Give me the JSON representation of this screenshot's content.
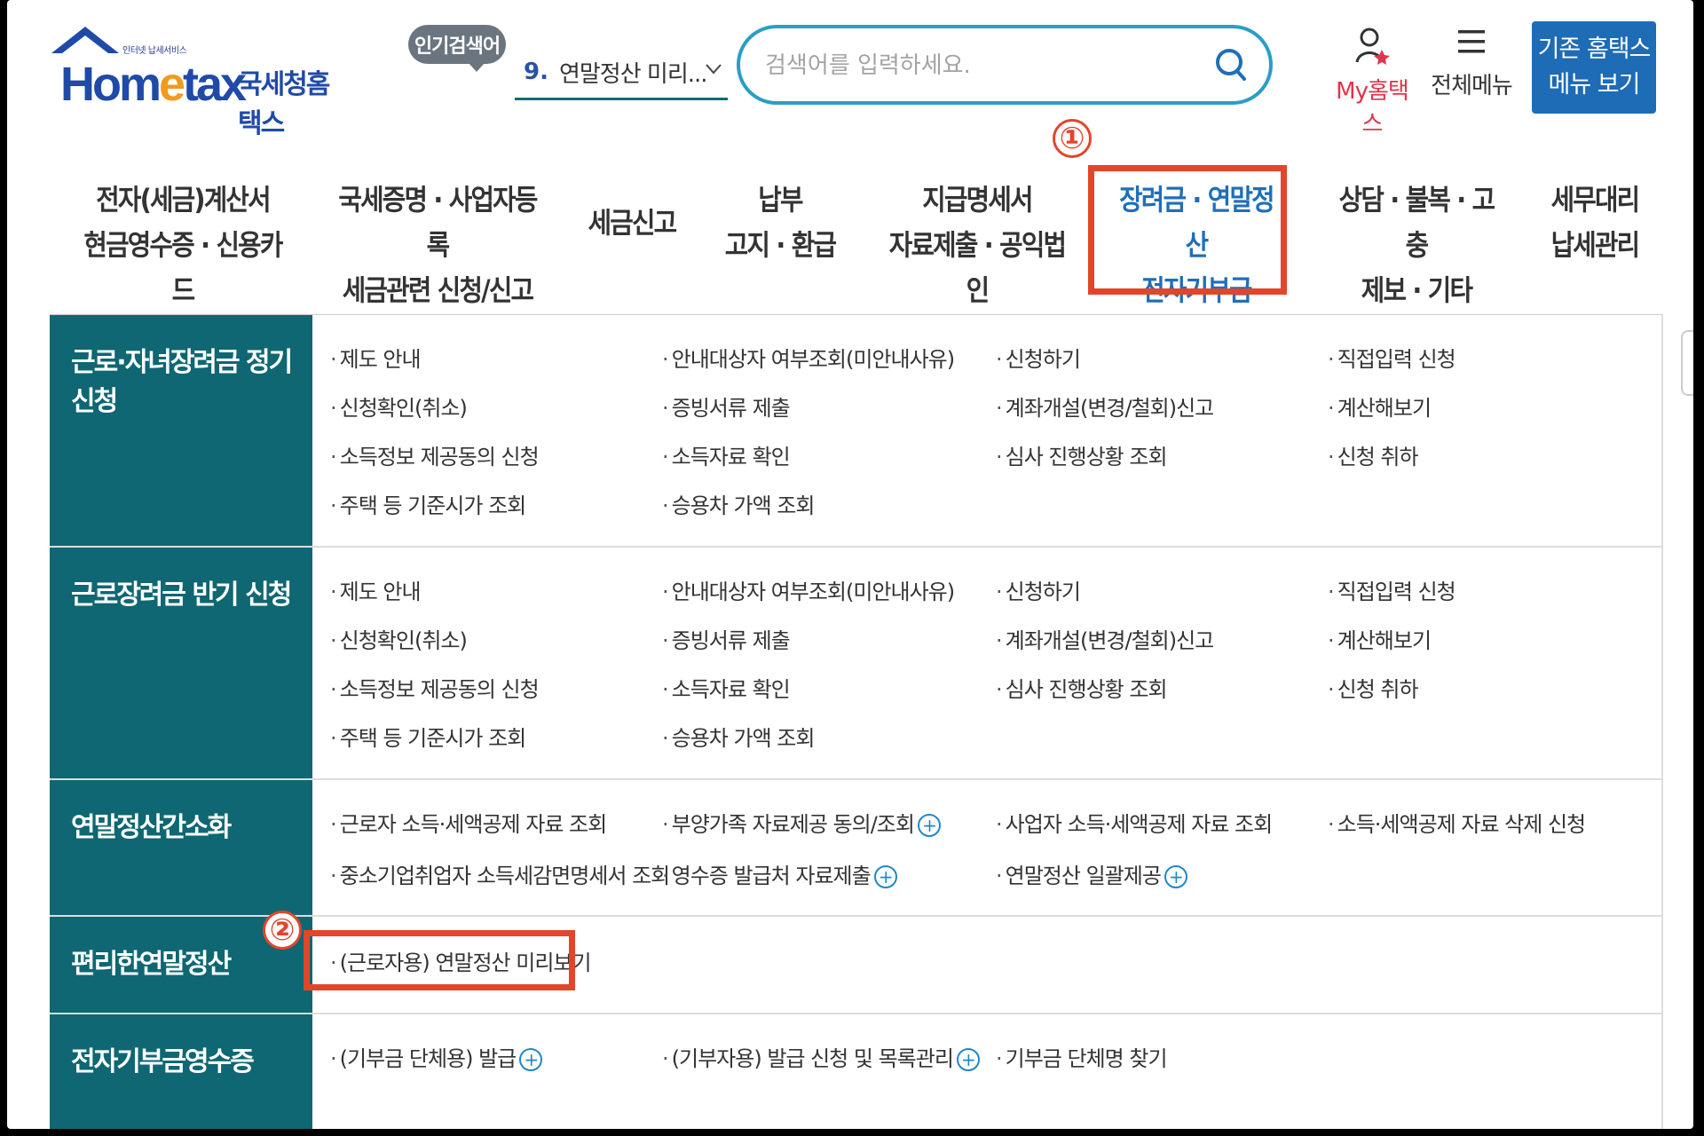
{
  "logo": {
    "small_text": "인터넷 납세서비스",
    "brand_pre": "Hom",
    "brand_e": "e",
    "brand_post": "tax",
    "brand_kor": "국세청홈택스"
  },
  "header": {
    "popular_badge": "인기검색어",
    "popular_num": "9.",
    "popular_text": "연말정산 미리...",
    "search_placeholder": "검색어를 입력하세요.",
    "my_label": "My홈택스",
    "all_menu_label": "전체메뉴",
    "legacy_line1": "기존 홈택스",
    "legacy_line2": "메뉴 보기"
  },
  "annotations": {
    "first": "①",
    "second": "②"
  },
  "nav": [
    {
      "line1": "전자(세금)계산서",
      "line2": "현금영수증 · 신용카드"
    },
    {
      "line1": "국세증명 · 사업자등록",
      "line2": "세금관련 신청/신고"
    },
    {
      "line1": "세금신고",
      "line2": ""
    },
    {
      "line1": "납부",
      "line2": "고지 · 환급"
    },
    {
      "line1": "지급명세서",
      "line2": "자료제출 · 공익법인"
    },
    {
      "line1": "장려금 · 연말정산",
      "line2": "전자기부금"
    },
    {
      "line1": "상담 · 불복 · 고충",
      "line2": "제보 · 기타"
    },
    {
      "line1": "세무대리",
      "line2": "납세관리"
    }
  ],
  "sections": [
    {
      "title": "근로·자녀장려금 정기 신청",
      "items": [
        "제도 안내",
        "안내대상자 여부조회(미안내사유)",
        "신청하기",
        "직접입력 신청",
        "신청확인(취소)",
        "증빙서류 제출",
        "계좌개설(변경/철회)신고",
        "계산해보기",
        "소득정보 제공동의 신청",
        "소득자료 확인",
        "심사 진행상황 조회",
        "신청 취하",
        "주택 등 기준시가 조회",
        "승용차 가액 조회"
      ]
    },
    {
      "title": "근로장려금 반기 신청",
      "items": [
        "제도 안내",
        "안내대상자 여부조회(미안내사유)",
        "신청하기",
        "직접입력 신청",
        "신청확인(취소)",
        "증빙서류 제출",
        "계좌개설(변경/철회)신고",
        "계산해보기",
        "소득정보 제공동의 신청",
        "소득자료 확인",
        "심사 진행상황 조회",
        "신청 취하",
        "주택 등 기준시가 조회",
        "승용차 가액 조회"
      ]
    },
    {
      "title": "연말정산간소화",
      "items": [
        "근로자 소득·세액공제 자료 조회",
        "부양가족 자료제공 동의/조회",
        "사업자 소득·세액공제 자료 조회",
        "소득·세액공제 자료 삭제 신청",
        "중소기업취업자 소득세감면명세서 조회",
        "영수증 발급처 자료제출",
        "연말정산 일괄제공"
      ]
    },
    {
      "title": "편리한연말정산",
      "items": [
        "(근로자용) 연말정산 미리보기"
      ]
    },
    {
      "title": "전자기부금영수증",
      "items": [
        "(기부금 단체용) 발급",
        "(기부자용) 발급 신청 및 목록관리",
        "기부금 단체명 찾기"
      ]
    }
  ],
  "colors": {
    "teal": "#0e6772",
    "highlight": "#e2452b",
    "accent_blue": "#1f6fb8",
    "pink": "#e0344c"
  }
}
